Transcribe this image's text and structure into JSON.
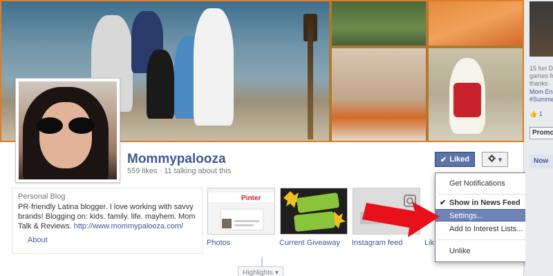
{
  "page": {
    "name": "Mommypalooza",
    "stats": "559 likes · 11 talking about this"
  },
  "actions": {
    "liked_label": "Liked",
    "liked_check": "✔",
    "gear_icon": "gear-icon",
    "caret": "▾"
  },
  "about": {
    "category": "Personal Blog",
    "description": "PR-friendly Latina blogger. I love working with savvy brands! Blogging on: kids. family. life. mayhem. Mom Talk & Reviews.",
    "link": "http://www.mommypalooza.com/",
    "label": "About"
  },
  "apps": [
    {
      "label": "Photos"
    },
    {
      "label": "Current Giveaway"
    },
    {
      "label": "Instagram feed"
    },
    {
      "label": "Lik"
    }
  ],
  "dropdown": {
    "items": [
      {
        "label": "Get Notifications"
      },
      {
        "label": "Show in News Feed",
        "check": "✔"
      },
      {
        "label": "Settings..."
      },
      {
        "label": "Add to Interest Lists..."
      },
      {
        "label": "Unlike"
      }
    ]
  },
  "timeline": {
    "highlights_label": "Highlights",
    "caret": "▾"
  },
  "sidebar": {
    "lines": [
      "15 fun D",
      "games fr",
      "thanks",
      "Mom End",
      "#Summe"
    ],
    "like_count": "1",
    "promo_label": "Promo",
    "now_label": "Now"
  },
  "colors": {
    "brand": "#3b5998",
    "liked_button": "#5b74a8",
    "dropdown_highlight": "#6d84b4",
    "arrow": "#e8101a",
    "cover_border": "#e07b26"
  }
}
